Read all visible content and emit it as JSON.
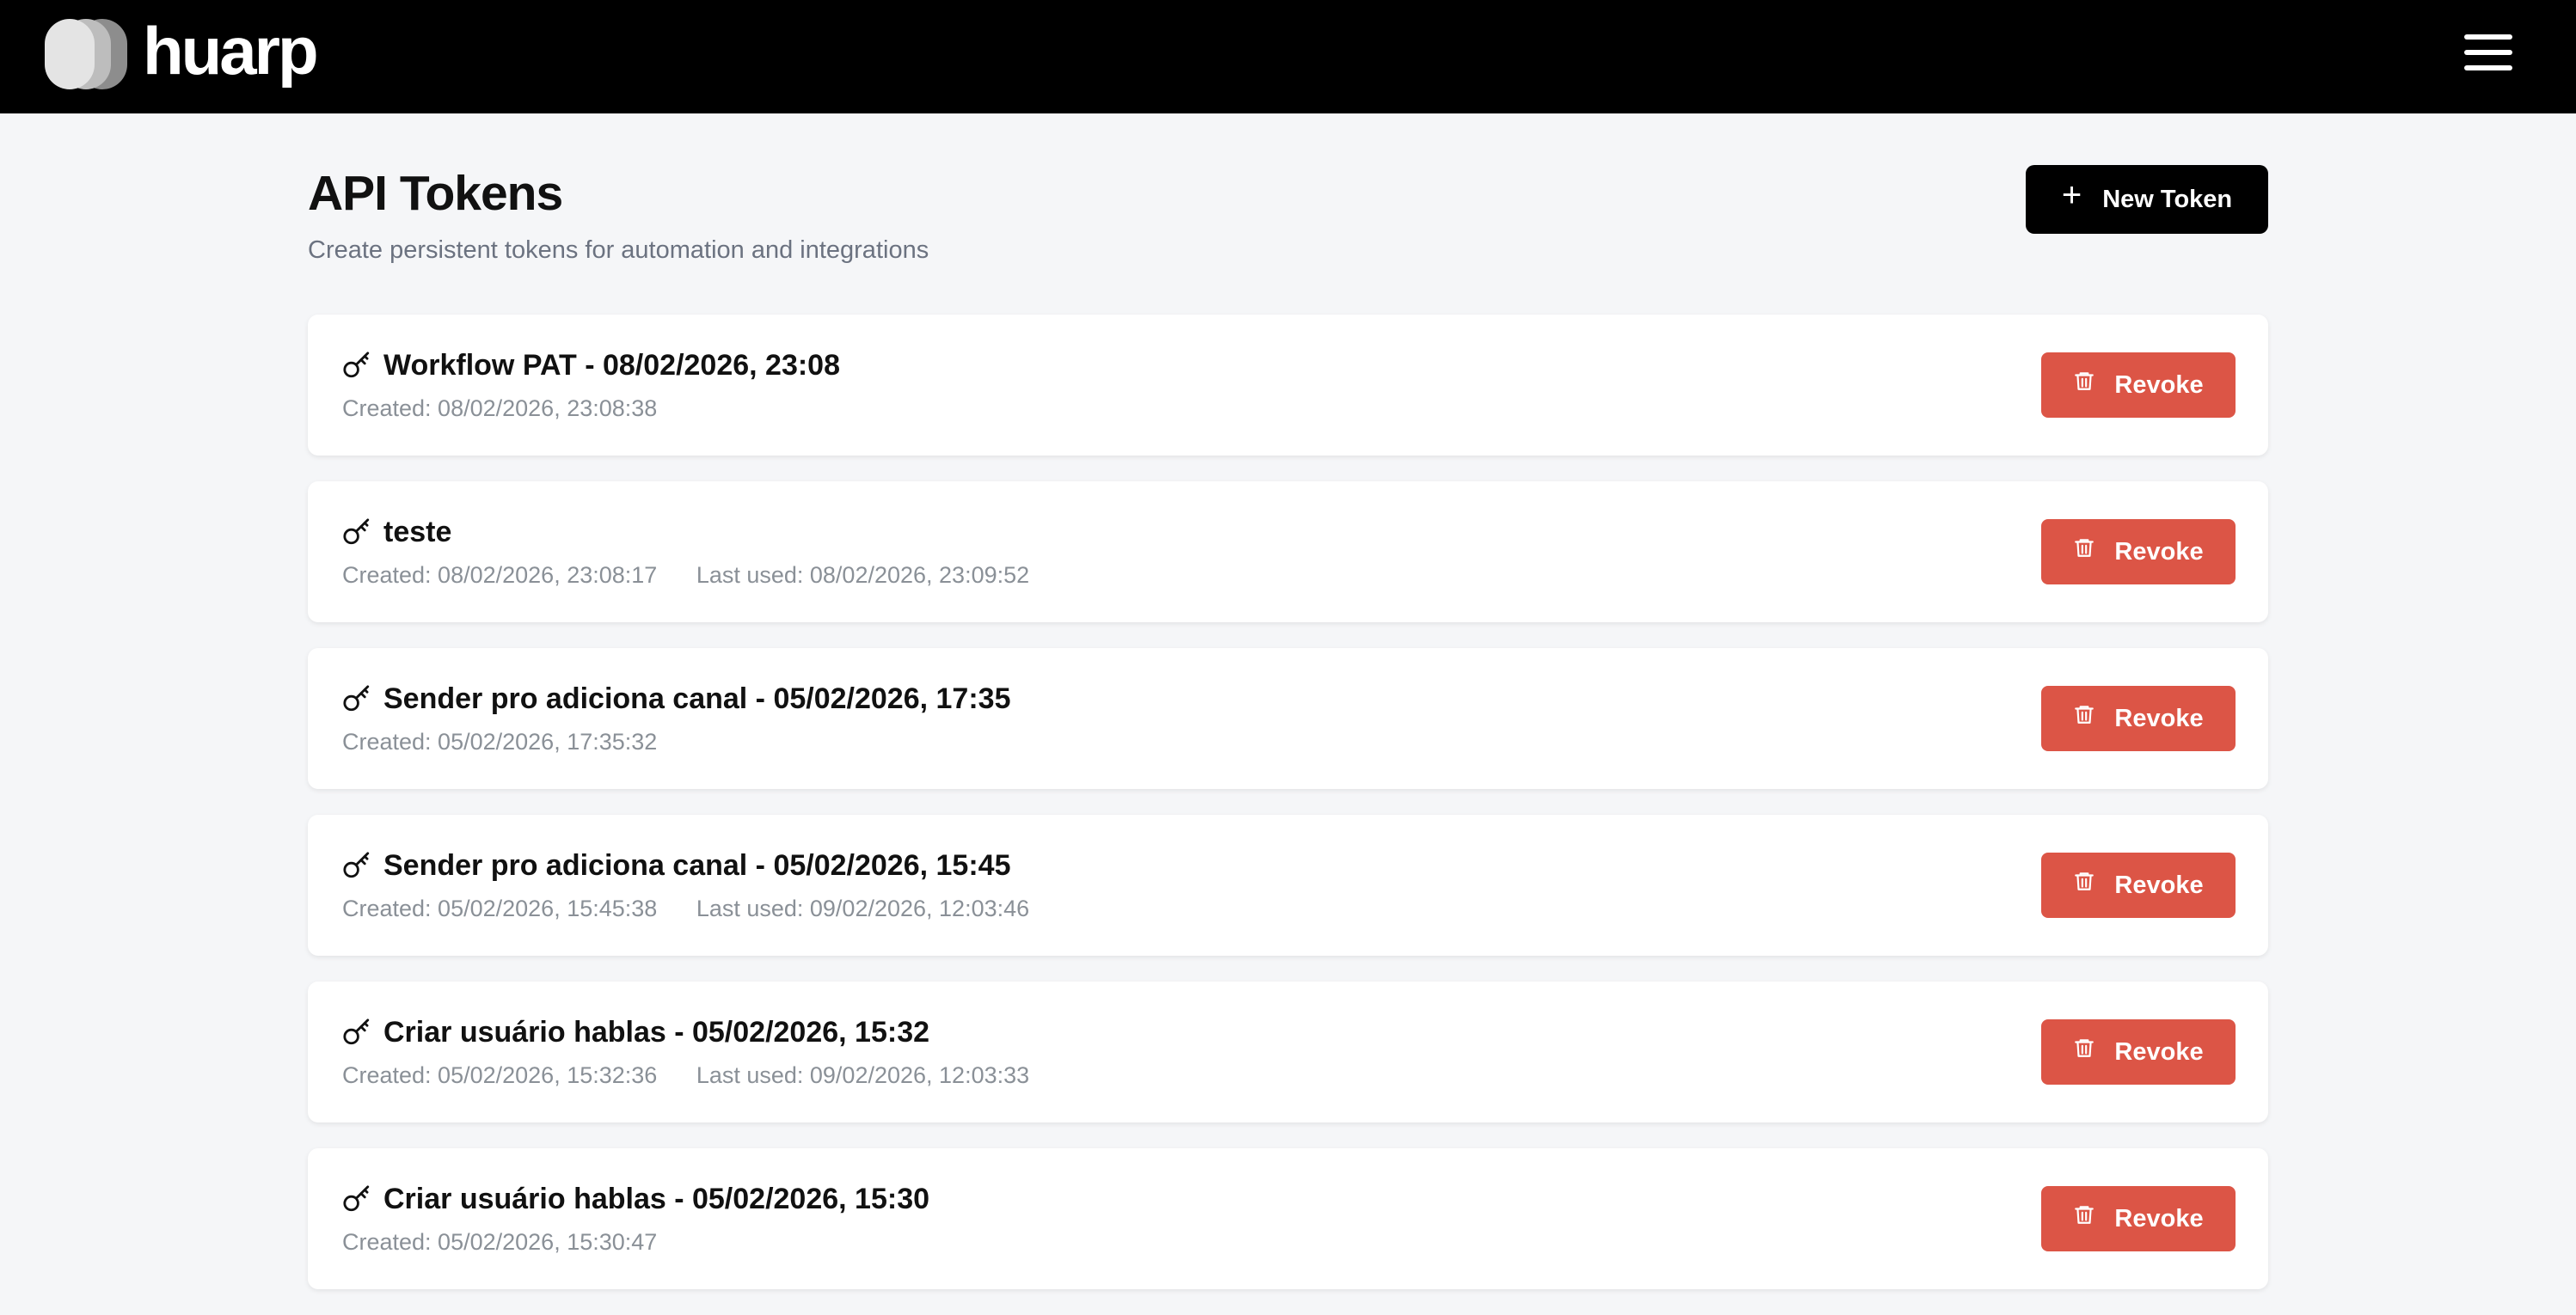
{
  "header": {
    "logo_text": "huarp"
  },
  "page": {
    "title": "API Tokens",
    "subtitle": "Create persistent tokens for automation and integrations",
    "new_token_label": "New Token"
  },
  "tokens": [
    {
      "name": "Workflow PAT - 08/02/2026, 23:08",
      "created": "Created: 08/02/2026, 23:08:38",
      "last_used": "",
      "revoke_label": "Revoke"
    },
    {
      "name": "teste",
      "created": "Created: 08/02/2026, 23:08:17",
      "last_used": "Last used: 08/02/2026, 23:09:52",
      "revoke_label": "Revoke"
    },
    {
      "name": "Sender pro adiciona canal - 05/02/2026, 17:35",
      "created": "Created: 05/02/2026, 17:35:32",
      "last_used": "",
      "revoke_label": "Revoke"
    },
    {
      "name": "Sender pro adiciona canal - 05/02/2026, 15:45",
      "created": "Created: 05/02/2026, 15:45:38",
      "last_used": "Last used: 09/02/2026, 12:03:46",
      "revoke_label": "Revoke"
    },
    {
      "name": "Criar usuário hablas - 05/02/2026, 15:32",
      "created": "Created: 05/02/2026, 15:32:36",
      "last_used": "Last used: 09/02/2026, 12:03:33",
      "revoke_label": "Revoke"
    },
    {
      "name": "Criar usuário hablas - 05/02/2026, 15:30",
      "created": "Created: 05/02/2026, 15:30:47",
      "last_used": "",
      "revoke_label": "Revoke"
    }
  ],
  "icons": {
    "logo": "huarp-logo-mark",
    "menu": "hamburger-menu-icon",
    "new_token": "plus-icon",
    "token": "key-icon",
    "revoke": "trash-icon"
  },
  "colors": {
    "header_bg": "#000000",
    "page_bg": "#f5f6f8",
    "primary_button": "#000000",
    "revoke_button": "#dc5546",
    "muted_text": "#8a9097"
  }
}
